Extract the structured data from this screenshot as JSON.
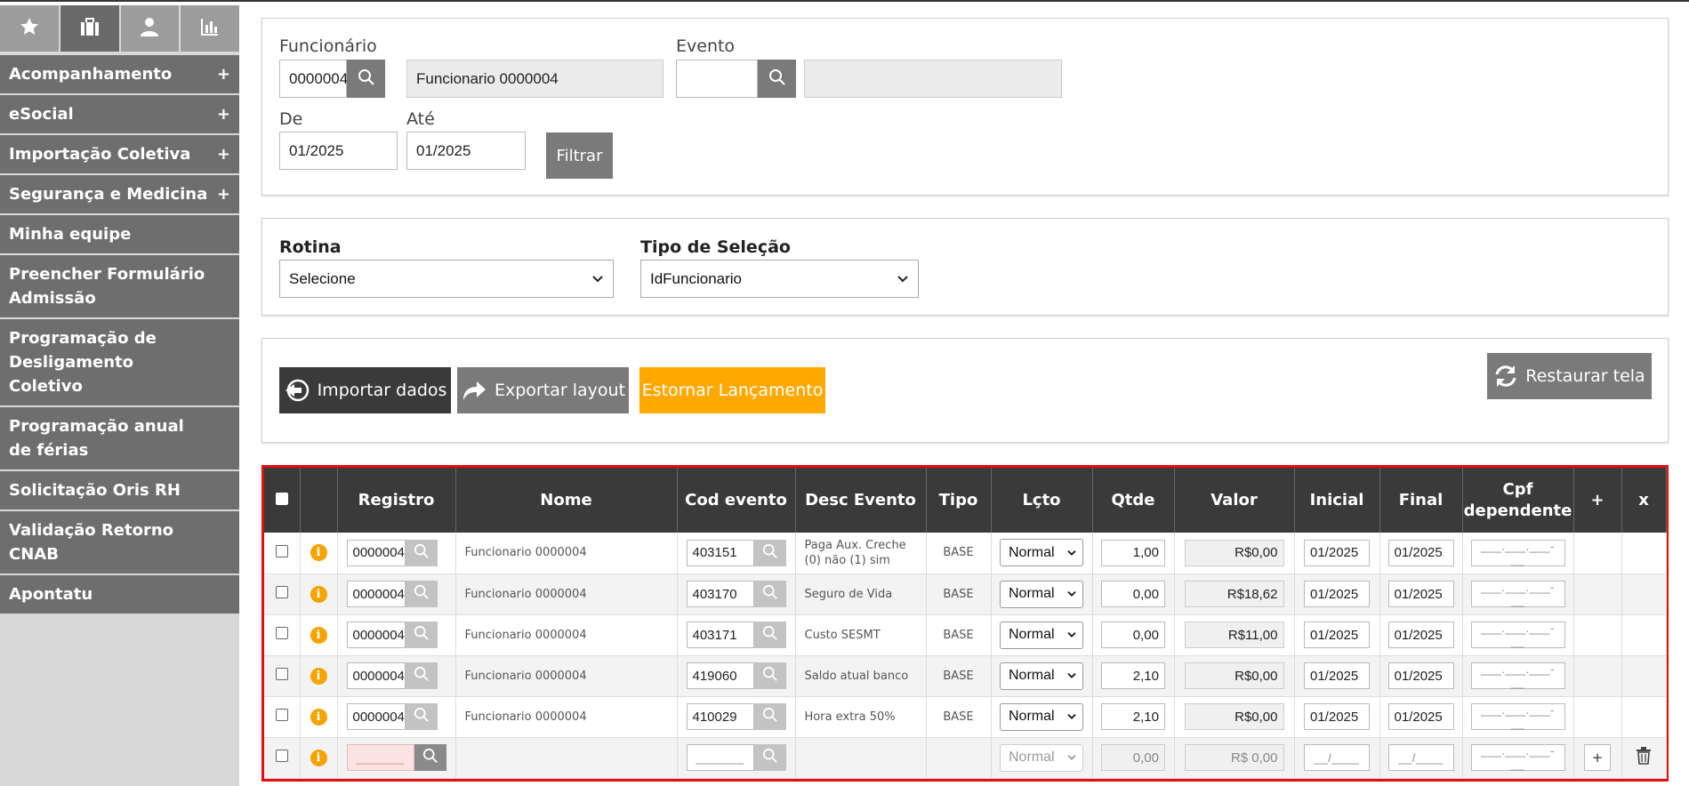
{
  "sidebar": {
    "tabs": [
      {
        "icon": "star-icon",
        "active": false
      },
      {
        "icon": "briefcase-icon",
        "active": true
      },
      {
        "icon": "user-icon",
        "active": false
      },
      {
        "icon": "chart-icon",
        "active": false
      }
    ],
    "items": [
      {
        "label": "Acompanhamento",
        "plus": "+"
      },
      {
        "label": "eSocial",
        "plus": "+"
      },
      {
        "label": "Importação Coletiva",
        "plus": "+"
      },
      {
        "label": "Segurança e Medicina",
        "plus": "+"
      },
      {
        "label": "Minha equipe",
        "plus": ""
      },
      {
        "label": "Preencher Formulário Admissão",
        "plus": ""
      },
      {
        "label": "Programação de Desligamento Coletivo",
        "plus": ""
      },
      {
        "label": "Programação anual de férias",
        "plus": ""
      },
      {
        "label": "Solicitação Oris RH",
        "plus": ""
      },
      {
        "label": "Validação Retorno CNAB",
        "plus": ""
      },
      {
        "label": "Apontatu",
        "plus": ""
      }
    ]
  },
  "filter": {
    "funcionario_label": "Funcionário",
    "funcionario_code": "0000004",
    "funcionario_name": "Funcionario 0000004",
    "evento_label": "Evento",
    "evento_code": "",
    "evento_name": "",
    "de_label": "De",
    "de_value": "01/2025",
    "ate_label": "Até",
    "ate_value": "01/2025",
    "filtrar_label": "Filtrar"
  },
  "selection": {
    "rotina_label": "Rotina",
    "rotina_value": "Selecione",
    "tipo_label": "Tipo de Seleção",
    "tipo_value": "IdFuncionario"
  },
  "actions": {
    "importar": "Importar dados",
    "exportar": "Exportar layout",
    "estornar": "Estornar Lançamento",
    "restaurar": "Restaurar tela",
    "colors": {
      "importar": "#3a3a3a",
      "exportar": "#7a7a7a",
      "estornar": "#ffa800",
      "restaurar": "#7a7a7a"
    }
  },
  "table": {
    "headers": [
      "Registro",
      "Nome",
      "Cod evento",
      "Desc Evento",
      "Tipo",
      "Lçto",
      "Qtde",
      "Valor",
      "Inicial",
      "Final",
      "Cpf dependente",
      "+",
      "x"
    ],
    "rows": [
      {
        "registro": "0000004",
        "nome": "Funcionario 0000004",
        "cod": "403151",
        "desc": "Paga Aux. Creche (0) não (1) sim",
        "tipo": "BASE",
        "lcto": "Normal",
        "qtde": "1,00",
        "valor": "R$0,00",
        "inicial": "01/2025",
        "final": "01/2025",
        "cpf": "___.___.___-__"
      },
      {
        "registro": "0000004",
        "nome": "Funcionario 0000004",
        "cod": "403170",
        "desc": "Seguro de Vida",
        "tipo": "BASE",
        "lcto": "Normal",
        "qtde": "0,00",
        "valor": "R$18,62",
        "inicial": "01/2025",
        "final": "01/2025",
        "cpf": "___.___.___-__"
      },
      {
        "registro": "0000004",
        "nome": "Funcionario 0000004",
        "cod": "403171",
        "desc": "Custo SESMT",
        "tipo": "BASE",
        "lcto": "Normal",
        "qtde": "0,00",
        "valor": "R$11,00",
        "inicial": "01/2025",
        "final": "01/2025",
        "cpf": "___.___.___-__"
      },
      {
        "registro": "0000004",
        "nome": "Funcionario 0000004",
        "cod": "419060",
        "desc": "Saldo atual banco",
        "tipo": "BASE",
        "lcto": "Normal",
        "qtde": "2,10",
        "valor": "R$0,00",
        "inicial": "01/2025",
        "final": "01/2025",
        "cpf": "___.___.___-__"
      },
      {
        "registro": "0000004",
        "nome": "Funcionario 0000004",
        "cod": "410029",
        "desc": "Hora extra 50%",
        "tipo": "BASE",
        "lcto": "Normal",
        "qtde": "2,10",
        "valor": "R$0,00",
        "inicial": "01/2025",
        "final": "01/2025",
        "cpf": "___.___.___-__"
      }
    ],
    "new_row": {
      "registro": "_______",
      "cod": "_______",
      "lcto": "Normal",
      "qtde": "0,00",
      "valor": "R$ 0,00",
      "inicial": "__/____",
      "final": "__/____",
      "cpf": "___.___.___-__",
      "plus": "+"
    }
  }
}
